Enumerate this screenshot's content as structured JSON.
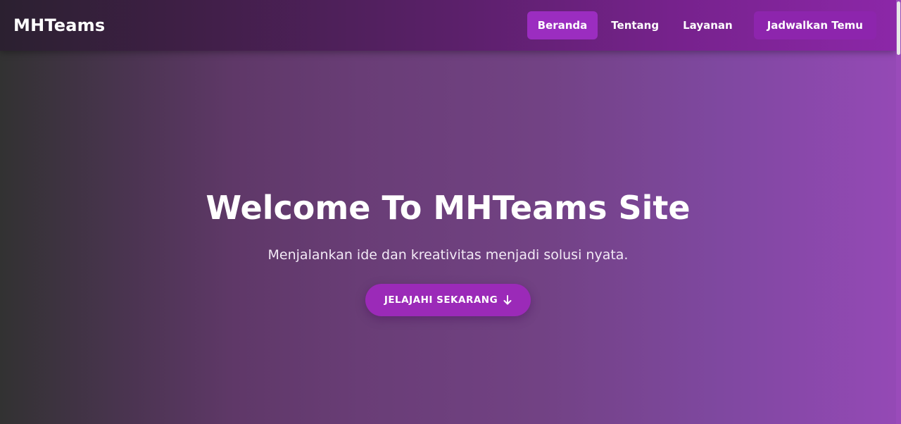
{
  "navbar": {
    "brand": "MHTeams",
    "links": [
      {
        "label": "Beranda",
        "active": true
      },
      {
        "label": "Tentang",
        "active": false
      },
      {
        "label": "Layanan",
        "active": false
      }
    ],
    "cta_label": "Jadwalkan Temu"
  },
  "hero": {
    "title": "Welcome To MHTeams Site",
    "subtitle": "Menjalankan ide dan kreativitas menjadi solusi nyata.",
    "button_label": "JELAJAHI SEKARANG",
    "button_icon": "arrow-down-icon"
  },
  "colors": {
    "accent": "#9b2ab8",
    "nav_active": "#9b2dc0",
    "text": "#ffffff"
  }
}
